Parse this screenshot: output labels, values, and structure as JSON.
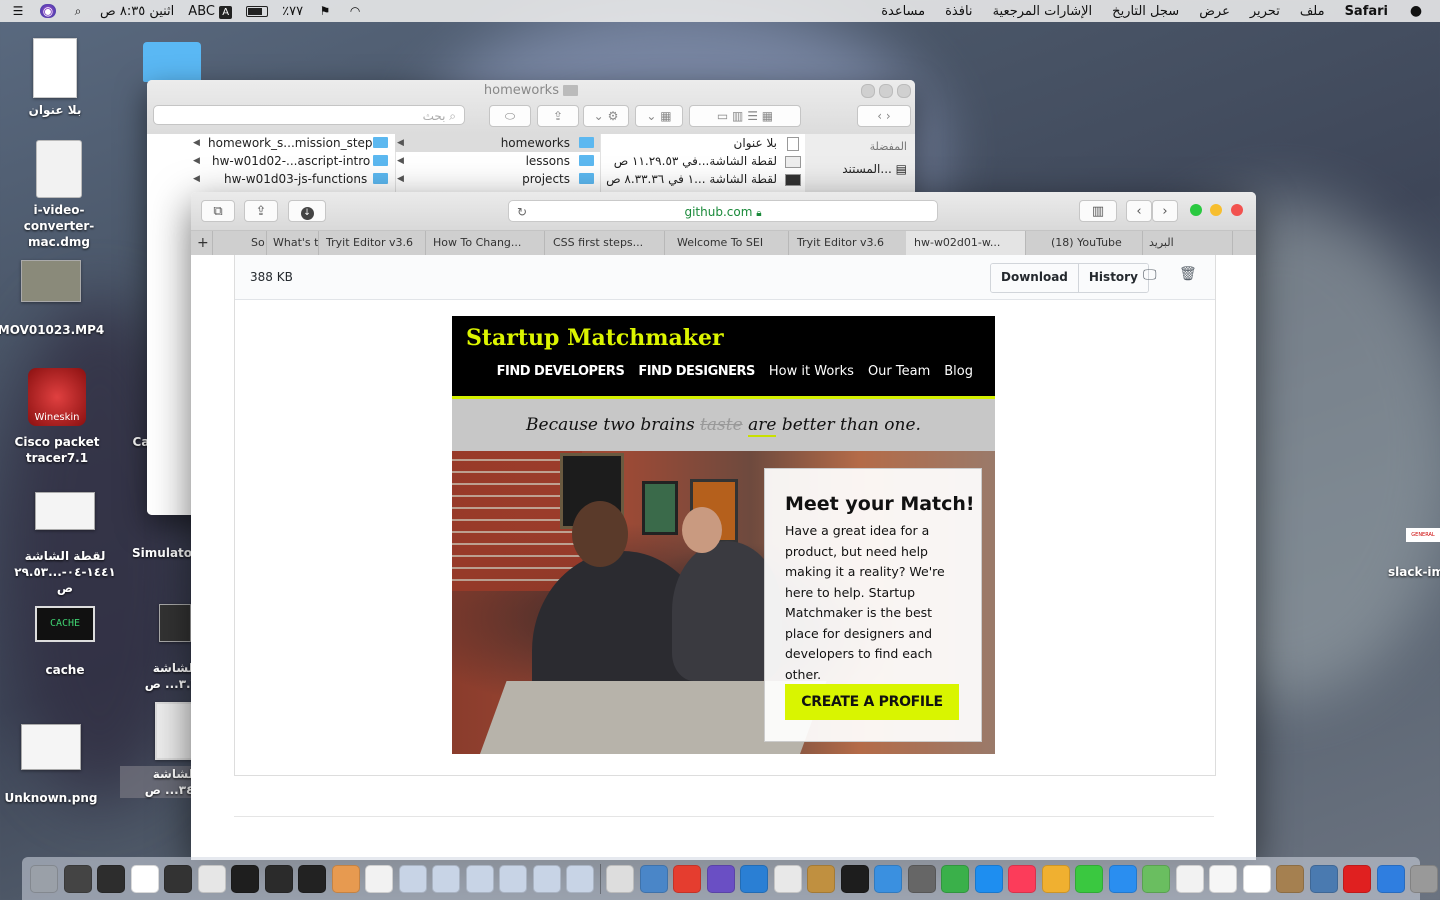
{
  "menubar": {
    "app_name": "Safari",
    "menus": [
      "ملف",
      "تحرير",
      "عرض",
      "سجل التاريخ",
      "الإشارات المرجعية",
      "نافذة",
      "مساعدة"
    ],
    "clock": "اثنين ٨:٣٥ ص",
    "battery": "٪٧٧",
    "input_source": "ABC"
  },
  "desktop": {
    "left_icons": [
      {
        "label": "بلا عنوان"
      },
      {
        "label_lines": [
          "i-video-converter-",
          "mac.dmg"
        ]
      },
      {
        "label": "MOV01023.MP4"
      },
      {
        "label_lines": [
          "Cisco packet",
          "tracer7.1"
        ],
        "badge": "Wineskin"
      },
      {
        "label_lines": [
          "لقطة الشاشة",
          "١٤٤١-٠٤-...٢٩.٥٣ ص"
        ]
      },
      {
        "label": "cache",
        "badge": "CACHE"
      },
      {
        "label": "Unknown.png"
      }
    ],
    "mid_icons": [
      {
        "label": "Ca"
      },
      {
        "label": "Simulator"
      },
      {
        "label_lines": [
          "الشاشة",
          "٣.٣٦... ص"
        ]
      },
      {
        "label_lines": [
          "الشاشة",
          "٣٤.٣... ص"
        ]
      }
    ],
    "right_icon": {
      "label": "slack-im",
      "badge": "GENERAL"
    }
  },
  "finder": {
    "title": "homeworks",
    "search_placeholder": "بحث",
    "col1": [
      {
        "name": "homework_s...mission_steps"
      },
      {
        "name": "hw-w01d02-...ascript-intro"
      },
      {
        "name": "hw-w01d03-js-functions"
      }
    ],
    "col2": [
      {
        "name": "homeworks",
        "selected": true
      },
      {
        "name": "lessons"
      },
      {
        "name": "projects"
      }
    ],
    "col3": [
      {
        "name": "بلا عنوان"
      },
      {
        "name": "لقطة الشاشة...في ١١.٢٩.٥٣ ص"
      },
      {
        "name": "لقطة الشاشة ...١ في ٨.٣٣.٣٦ ص"
      }
    ],
    "sidebar": {
      "heading": "المفضلة",
      "item": "المستند..."
    }
  },
  "safari": {
    "url": "github.com",
    "tabs": [
      {
        "label": "So"
      },
      {
        "label": "What's t"
      },
      {
        "label": "Tryit Editor v3.6"
      },
      {
        "label": "How To Chang..."
      },
      {
        "label": "CSS first steps..."
      },
      {
        "label": "Welcome To SEI"
      },
      {
        "label": "Tryit Editor v3.6"
      },
      {
        "label": "hw-w02d01-w...",
        "active": true
      },
      {
        "label": "(18) YouTube"
      },
      {
        "label": "البريد"
      }
    ],
    "file": {
      "size": "388  KB",
      "download_label": "Download",
      "history_label": "History"
    },
    "preview": {
      "logo": "Startup Matchmaker",
      "nav": [
        "FIND DEVELOPERS",
        "FIND DESIGNERS",
        "How it Works",
        "Our Team",
        "Blog"
      ],
      "tagline_a": "Because two brains",
      "tagline_struck": "taste",
      "tagline_ul": "are",
      "tagline_b": "better than one.",
      "card_title": "Meet your Match!",
      "card_text": "Have a great idea for a product, but need help making it a reality? We're here to help. Startup Matchmaker is the best place for designers and developers to find each other.",
      "cta": "CREATE A PROFILE"
    }
  },
  "dock": {
    "colors": [
      "#9aa0a8",
      "#444",
      "#2d2d2d",
      "#fff",
      "#333",
      "#e6e6e6",
      "#1e1e1e",
      "#2b2b2b",
      "#222",
      "#e79a50",
      "#f2f2f2",
      "#c8d4e6",
      "#c8d4e6",
      "#c8d4e6",
      "#c8d4e6",
      "#c8d4e6",
      "#c8d4e6",
      "#ddd",
      "#4a86c8",
      "#e53d2f",
      "#6a4fc4",
      "#2a7fd4",
      "#e8e8e8",
      "#c09040",
      "#1d1d1d",
      "#3a90e0",
      "#666",
      "#3ab04a",
      "#1e8ef0",
      "#fc3c5a",
      "#f0b030",
      "#3ac840",
      "#2a8ef0",
      "#6abe60",
      "#f2f2f2",
      "#f6f6f6",
      "#fff",
      "#a58050",
      "#4a7ab0",
      "#e02020",
      "#2f7ee0",
      "#999",
      "#7050c0",
      "#3a9af0"
    ]
  }
}
